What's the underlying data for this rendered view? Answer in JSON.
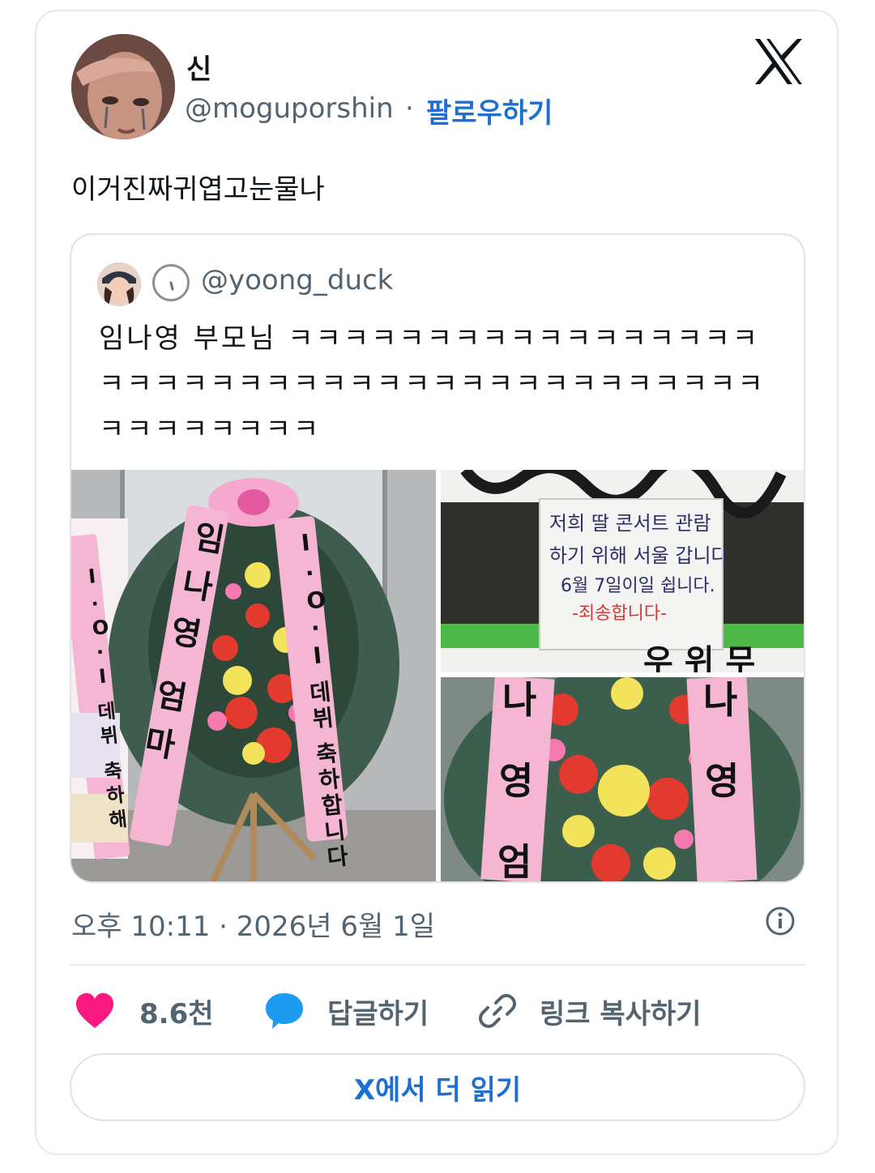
{
  "author": {
    "display_name": "신",
    "handle": "@moguporshin",
    "separator": "·",
    "follow_label": "팔로우하기"
  },
  "tweet": {
    "text": "이거진짜귀엽고눈물나",
    "timestamp": "오후 10:11 · 2026년 6월 1일"
  },
  "quote": {
    "handle": "@yoong_duck",
    "text": "임나영 부모님 ㅋㅋㅋㅋㅋㅋㅋㅋㅋㅋㅋㅋㅋㅋㅋㅋㅋㅋㅋㅋㅋㅋㅋㅋㅋㅋㅋㅋㅋㅋㅋㅋㅋㅋㅋㅋㅋㅋㅋㅋㅋㅋㅋㅋㅋㅋㅋㅋㅋ",
    "photos": {
      "photo1": {
        "ribbon_left": "임나영 엄마",
        "ribbon_right": "I·O·I 데뷔 축하합니다",
        "side_ribbon": "I·O·I 데뷔 축하해"
      },
      "photo2": {
        "sign_line1": "저희 딸 콘서트 관람",
        "sign_line2": "하기 위해 서울 갑니다",
        "sign_line3": "6월 7일이일 쉽니다.",
        "sign_line4": "-죄송합니다-",
        "bottom_text": "우 위 무"
      },
      "photo3": {
        "ribbon_left": "나영 엄",
        "ribbon_right": "나영"
      }
    }
  },
  "actions": {
    "like_count": "8.6천",
    "reply_label": "답글하기",
    "copy_link_label": "링크 복사하기"
  },
  "read_more_label": "X에서 더 읽기",
  "colors": {
    "accent": "#1d6fd1",
    "like": "#f91880",
    "reply_bubble": "#1d9bf0",
    "muted": "#536471",
    "ribbon_pink": "#f4b6d2"
  },
  "icons": {
    "x_logo": "x-logo-icon",
    "info": "info-icon",
    "like": "heart-icon",
    "reply": "speech-bubble-icon",
    "copy_link": "link-icon",
    "verified_badge": "clock-badge-icon"
  }
}
